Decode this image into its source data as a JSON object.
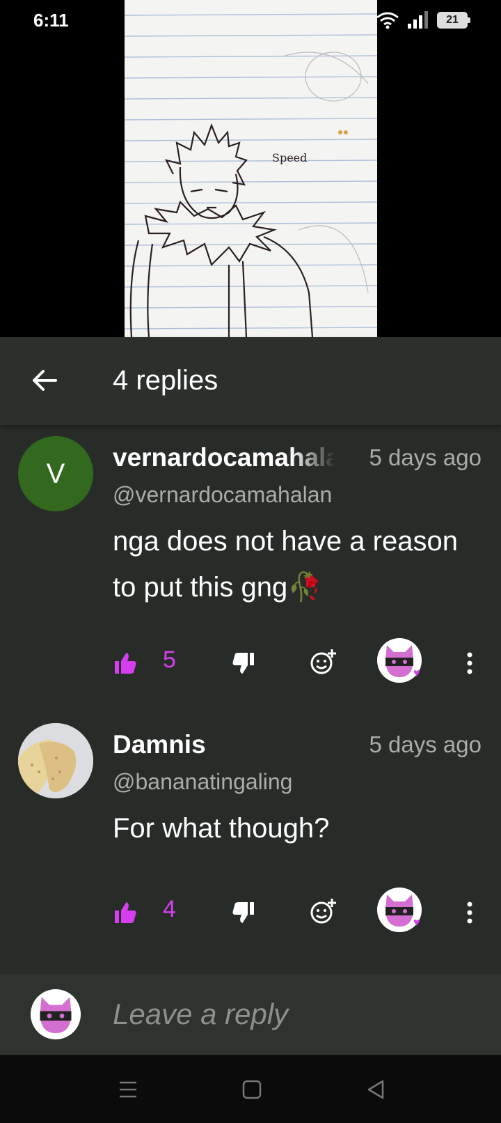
{
  "status_bar": {
    "time": "6:11",
    "battery": "21",
    "icons": [
      "wifi-icon",
      "signal-icon",
      "battery-icon"
    ]
  },
  "video": {
    "sketch_label": "Speed"
  },
  "header": {
    "title": "4 replies",
    "back_icon": "arrow-left-icon"
  },
  "comments": [
    {
      "avatar_letter": "V",
      "avatar_color": "#33691e",
      "username": "vernardocamahalan",
      "time": "5 days ago",
      "handle": "@vernardocamahalan",
      "text": "nga does not have a reason to put this gng🥀",
      "likes": "5"
    },
    {
      "avatar": "banana-photo",
      "username": "Damnis",
      "time": "5 days ago",
      "handle": "@bananatingaling",
      "text": "For what though?",
      "likes": "4"
    }
  ],
  "reply": {
    "placeholder": "Leave a reply"
  },
  "colors": {
    "accent": "#d63ff0",
    "panel": "#282c28",
    "header": "#2c302c"
  },
  "nav": {
    "icons": [
      "menu-icon",
      "home-icon",
      "back-icon"
    ]
  }
}
